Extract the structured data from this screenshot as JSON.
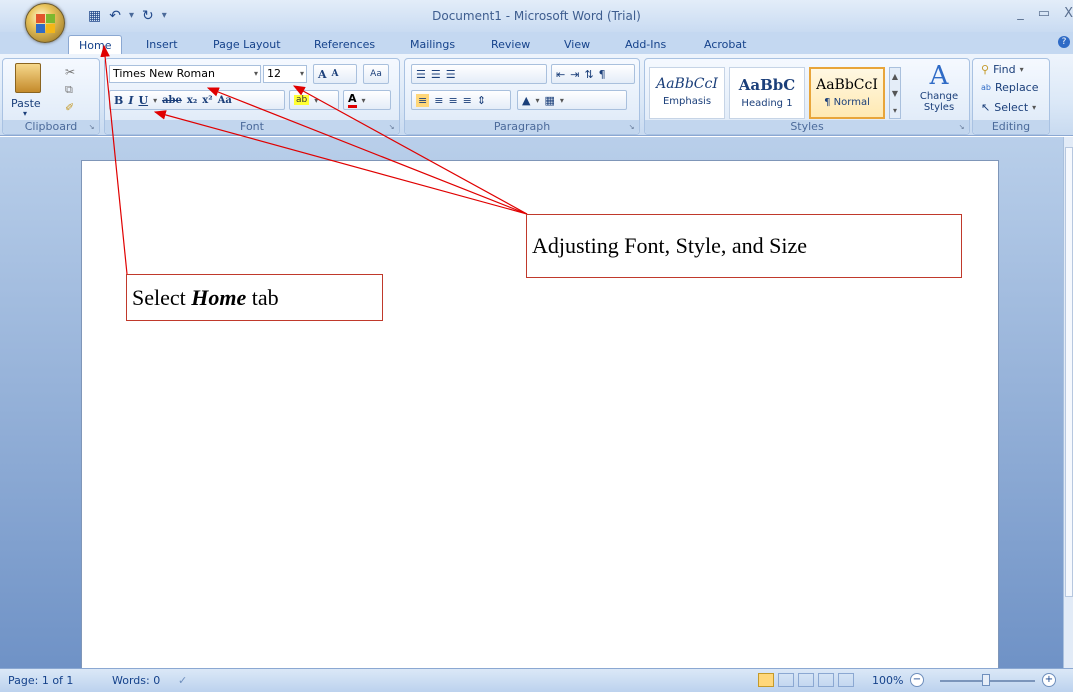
{
  "window": {
    "title": "Document1 - Microsoft Word (Trial)",
    "controls": [
      "_",
      "▭",
      "X"
    ]
  },
  "quick_access": {
    "icons": [
      "save-icon",
      "undo-icon",
      "redo-icon"
    ]
  },
  "tabs": [
    "Home",
    "Insert",
    "Page Layout",
    "References",
    "Mailings",
    "Review",
    "View",
    "Add-Ins",
    "Acrobat"
  ],
  "active_tab": "Home",
  "ribbon": {
    "clipboard": {
      "paste": "Paste",
      "label": "Clipboard"
    },
    "font": {
      "font_name": "Times New Roman",
      "font_size": "12",
      "label": "Font",
      "bold": "B",
      "italic": "I",
      "underline": "U",
      "strike": "abe",
      "subscript": "x₂",
      "superscript": "x²",
      "change_case": "Aa",
      "grow": "A",
      "shrink": "A",
      "clear": "Aa"
    },
    "paragraph": {
      "label": "Paragraph"
    },
    "styles": {
      "label": "Styles",
      "items": [
        {
          "preview": "AaBbCcI",
          "name": "Emphasis"
        },
        {
          "preview": "AaBbC",
          "name": "Heading 1"
        },
        {
          "preview": "AaBbCcI",
          "name": "¶ Normal"
        }
      ],
      "change_styles": "Change Styles"
    },
    "editing": {
      "label": "Editing",
      "find": "Find",
      "replace": "Replace",
      "select": "Select"
    }
  },
  "status": {
    "page": "Page: 1 of 1",
    "words": "Words: 0",
    "zoom": "100%"
  },
  "annotations": {
    "font_callout": "Adjusting Font, Style, and Size",
    "home_callout_prefix": "Select ",
    "home_callout_bold": "Home",
    "home_callout_suffix": " tab"
  },
  "colors": {
    "arrow": "#e00000",
    "ribbon_text": "#15428b"
  }
}
